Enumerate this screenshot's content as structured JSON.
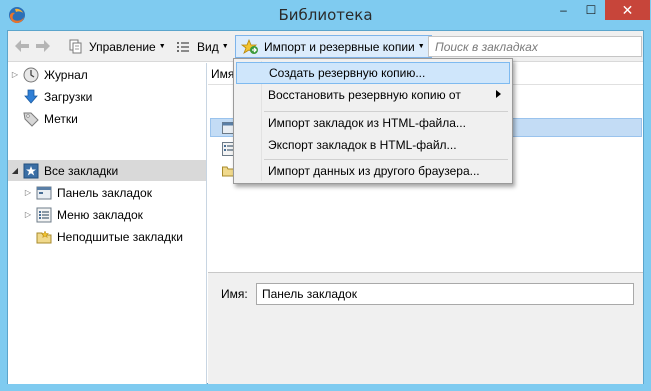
{
  "window": {
    "title": "Библиотека",
    "minimize": "–",
    "maximize": "☐",
    "close": "✕",
    "accent_color": "#7fcbf0",
    "close_color": "#c7453a"
  },
  "toolbar": {
    "manage_label": "Управление",
    "view_label": "Вид",
    "import_label": "Импорт и резервные копии",
    "search_placeholder": "Поиск в закладках"
  },
  "tree": {
    "items": [
      {
        "label": "Журнал",
        "icon": "clock-icon"
      },
      {
        "label": "Загрузки",
        "icon": "download-arrow-icon"
      },
      {
        "label": "Метки",
        "icon": "tag-icon"
      },
      {
        "label": "Все закладки",
        "icon": "bookmarks-star-icon"
      },
      {
        "label": "Панель закладок",
        "icon": "bookmarks-toolbar-icon"
      },
      {
        "label": "Меню закладок",
        "icon": "bookmarks-menu-icon"
      },
      {
        "label": "Неподшитые закладки",
        "icon": "unsorted-folder-icon"
      }
    ]
  },
  "list": {
    "column_header": "Имя"
  },
  "details": {
    "name_label": "Имя:",
    "name_value": "Панель закладок"
  },
  "menu": {
    "items": [
      {
        "label": "Создать резервную копию..."
      },
      {
        "label": "Восстановить резервную копию от"
      },
      {
        "label": "Импорт закладок из HTML-файла..."
      },
      {
        "label": "Экспорт закладок в HTML-файл..."
      },
      {
        "label": "Импорт данных из другого браузера..."
      }
    ]
  }
}
